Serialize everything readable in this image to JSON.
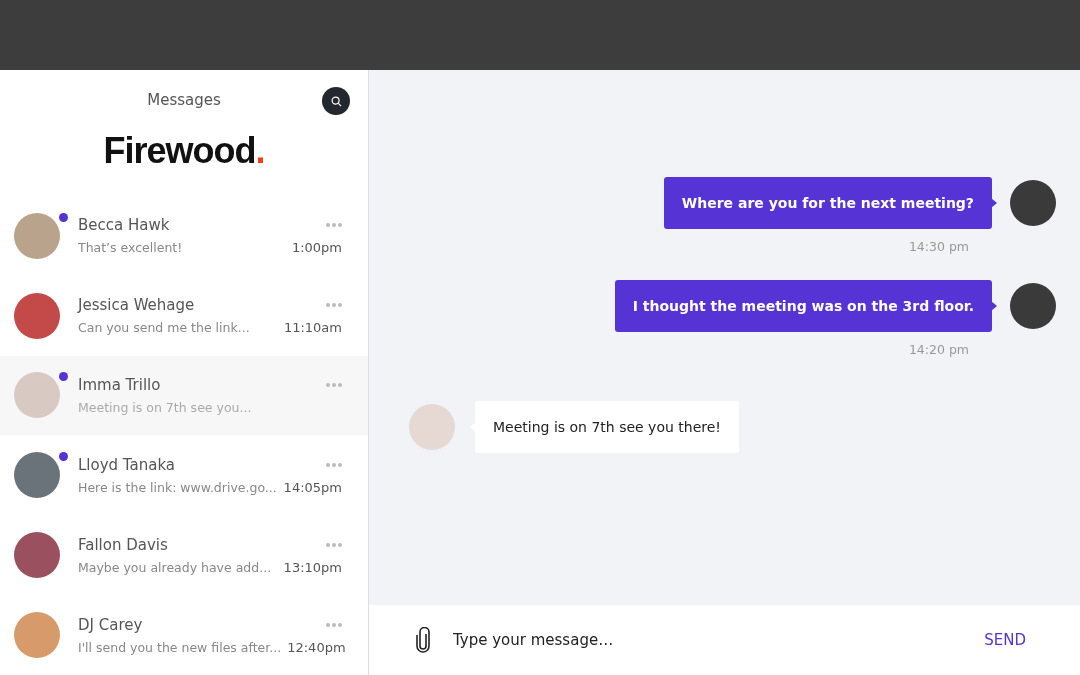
{
  "sidebar": {
    "title": "Messages",
    "logo": {
      "text": "Firewood",
      "mark": "."
    },
    "conversations": [
      {
        "name": "Becca Hawk",
        "preview": "That’s excellent!",
        "time": "1:00pm",
        "unread": true,
        "selected": false
      },
      {
        "name": "Jessica Wehage",
        "preview": "Can you send me the link...",
        "time": "11:10am",
        "unread": false,
        "selected": false
      },
      {
        "name": "Imma Trillo",
        "preview": "Meeting is on 7th see you...",
        "unread": true,
        "selected": true
      },
      {
        "name": "Lloyd Tanaka",
        "preview": "Here is the link: www.drive.go...",
        "time": "14:05pm",
        "unread": true,
        "selected": false
      },
      {
        "name": "Fallon Davis",
        "preview": "Maybe you already have add...",
        "time": "13:10pm",
        "unread": false,
        "selected": false
      },
      {
        "name": "DJ Carey",
        "preview": "I'll send you the new files after...",
        "time": "12:40pm",
        "unread": false,
        "selected": false
      }
    ]
  },
  "chat": {
    "messages": [
      {
        "kind": "outgoing",
        "text": "Where are you for the next meeting?",
        "time": "14:30 pm"
      },
      {
        "kind": "outgoing",
        "text": "I thought the meeting was on the 3rd floor.",
        "time": "14:20 pm"
      },
      {
        "kind": "incoming",
        "text": "Meeting is on 7th see you there!"
      }
    ],
    "composer": {
      "placeholder": "Type your message…",
      "send": "SEND"
    }
  }
}
